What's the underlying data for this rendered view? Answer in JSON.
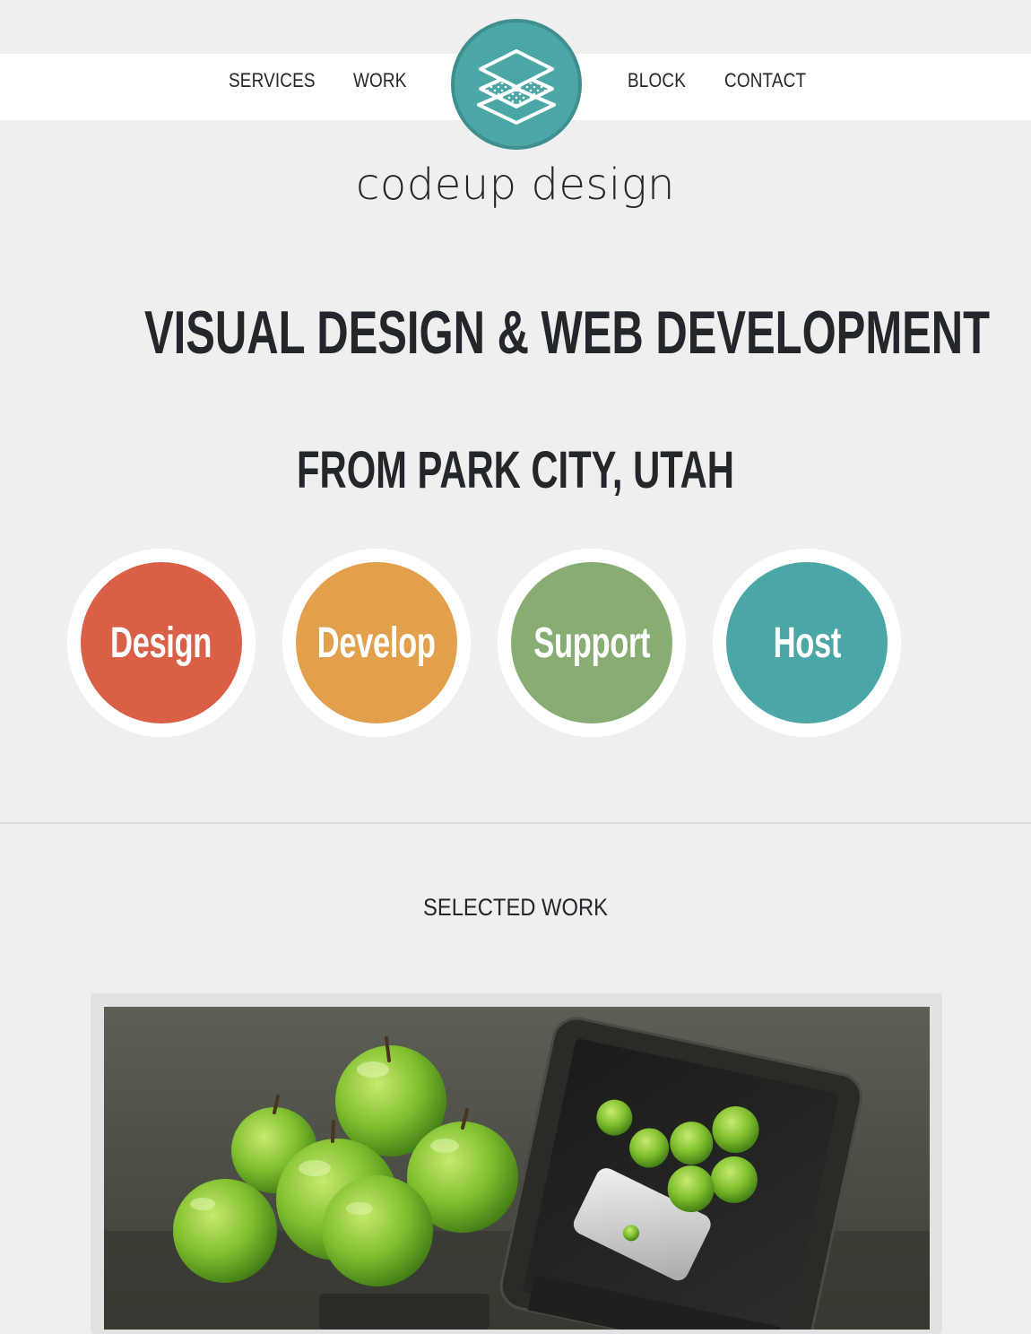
{
  "nav": {
    "items": [
      {
        "label": "SERVICES"
      },
      {
        "label": "WORK"
      },
      {
        "label": "BLOCK"
      },
      {
        "label": "CONTACT"
      }
    ]
  },
  "brand": {
    "name": "codeup design",
    "logo_icon": "layers-icon",
    "logo_color": "#4aa7a6"
  },
  "hero": {
    "title": "VISUAL DESIGN & WEB DEVELOPMENT",
    "subtitle": "FROM PARK CITY, UTAH"
  },
  "services": [
    {
      "label": "Design",
      "color": "#d95f47"
    },
    {
      "label": "Develop",
      "color": "#e2a04c"
    },
    {
      "label": "Support",
      "color": "#88ad72"
    },
    {
      "label": "Host",
      "color": "#4aa7a6"
    }
  ],
  "selected_work": {
    "heading": "SELECTED WORK"
  }
}
